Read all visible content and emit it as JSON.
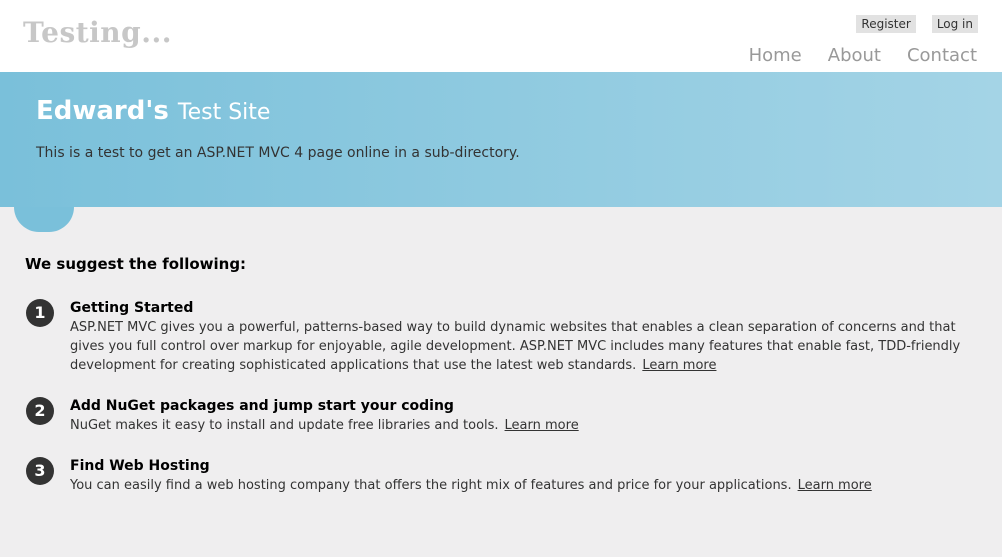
{
  "header": {
    "site_title": "Testing...",
    "register": "Register",
    "login": "Log in",
    "nav": [
      "Home",
      "About",
      "Contact"
    ]
  },
  "featured": {
    "title_bold": "Edward's",
    "title_rest": "Test Site",
    "description": "This is a test to get an ASP.NET MVC 4 page online in a sub-directory."
  },
  "content": {
    "heading": "We suggest the following:",
    "steps": [
      {
        "number": "1",
        "title": "Getting Started",
        "text": "ASP.NET MVC gives you a powerful, patterns-based way to build dynamic websites that enables a clean separation of concerns and that gives you full control over markup for enjoyable, agile development. ASP.NET MVC includes many features that enable fast, TDD-friendly development for creating sophisticated applications that use the latest web standards.",
        "link": "Learn more"
      },
      {
        "number": "2",
        "title": "Add NuGet packages and jump start your coding",
        "text": "NuGet makes it easy to install and update free libraries and tools.",
        "link": "Learn more"
      },
      {
        "number": "3",
        "title": "Find Web Hosting",
        "text": "You can easily find a web hosting company that offers the right mix of features and price for your applications.",
        "link": "Learn more"
      }
    ]
  },
  "colors": {
    "featured_start": "#7ac0da",
    "featured_end": "#a4d4e6",
    "body_bg": "#efeeef"
  }
}
